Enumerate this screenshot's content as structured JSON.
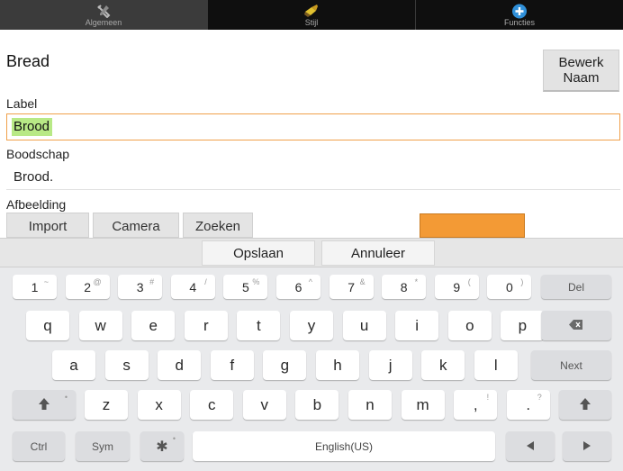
{
  "tabs": [
    {
      "label": "Algemeen",
      "icon": "tools-icon",
      "active": true
    },
    {
      "label": "Stijl",
      "icon": "paintbrush-icon",
      "active": false
    },
    {
      "label": "Functies",
      "icon": "plus-circle-icon",
      "active": false
    }
  ],
  "form": {
    "name": "Bread",
    "rename_button": {
      "line1": "Bewerk",
      "line2": "Naam"
    },
    "label_caption": "Label",
    "label_value": "Brood",
    "message_caption": "Boodschap",
    "message_value": "Brood.",
    "image_caption": "Afbeelding",
    "image_buttons": [
      "Import",
      "Camera",
      "Zoeken"
    ],
    "swatch_color": "#f39a35"
  },
  "keyboard": {
    "actions": {
      "save": "Opslaan",
      "cancel": "Annuleer"
    },
    "number_row": [
      {
        "k": "1",
        "s": "~"
      },
      {
        "k": "2",
        "s": "@"
      },
      {
        "k": "3",
        "s": "#"
      },
      {
        "k": "4",
        "s": "/"
      },
      {
        "k": "5",
        "s": "%"
      },
      {
        "k": "6",
        "s": "^"
      },
      {
        "k": "7",
        "s": "&"
      },
      {
        "k": "8",
        "s": "*"
      },
      {
        "k": "9",
        "s": "("
      },
      {
        "k": "0",
        "s": ")"
      }
    ],
    "del_label": "Del",
    "row_q": [
      "q",
      "w",
      "e",
      "r",
      "t",
      "y",
      "u",
      "i",
      "o",
      "p"
    ],
    "row_a": [
      "a",
      "s",
      "d",
      "f",
      "g",
      "h",
      "j",
      "k",
      "l"
    ],
    "next_label": "Next",
    "row_z": [
      {
        "k": "z",
        "s": ""
      },
      {
        "k": "x",
        "s": ""
      },
      {
        "k": "c",
        "s": ""
      },
      {
        "k": "v",
        "s": ""
      },
      {
        "k": "b",
        "s": ""
      },
      {
        "k": "n",
        "s": ""
      },
      {
        "k": "m",
        "s": ""
      },
      {
        "k": ",",
        "s": "!"
      },
      {
        "k": ".",
        "s": "?"
      }
    ],
    "ctrl_label": "Ctrl",
    "sym_label": "Sym",
    "space_label": "English(US)"
  }
}
